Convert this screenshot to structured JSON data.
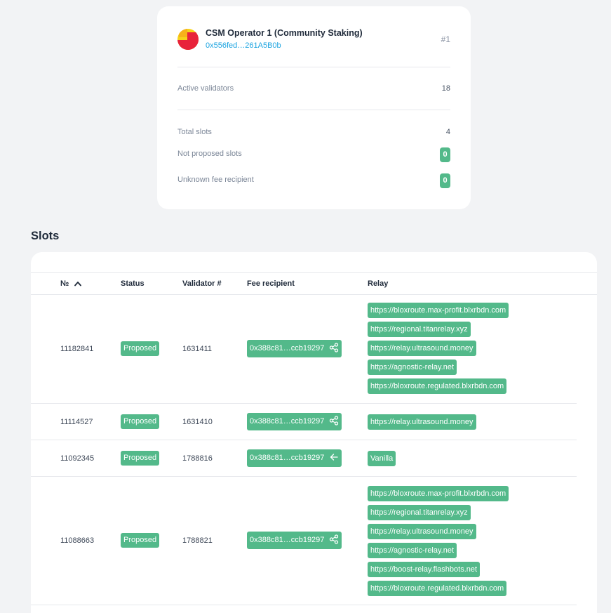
{
  "operator": {
    "name": "CSM Operator 1 (Community Staking)",
    "address": "0x556fed…261A5B0b",
    "rank": "#1",
    "active_validators_label": "Active validators",
    "active_validators": "18",
    "total_slots_label": "Total slots",
    "total_slots": "4",
    "not_proposed_label": "Not proposed slots",
    "not_proposed": "0",
    "unknown_fee_label": "Unknown fee recipient",
    "unknown_fee": "0"
  },
  "slots": {
    "title": "Slots",
    "columns": {
      "number": "№",
      "status": "Status",
      "validator": "Validator #",
      "fee_recipient": "Fee recipient",
      "relay": "Relay"
    },
    "rows": [
      {
        "slot": "11182841",
        "status": "Proposed",
        "validator": "1631411",
        "fee_recipient": "0x388c81…ccb19297",
        "fee_icon": "share-icon",
        "relays": [
          "https://bloxroute.max-profit.blxrbdn.com",
          "https://regional.titanrelay.xyz",
          "https://relay.ultrasound.money",
          "https://agnostic-relay.net",
          "https://bloxroute.regulated.blxrbdn.com"
        ]
      },
      {
        "slot": "11114527",
        "status": "Proposed",
        "validator": "1631410",
        "fee_recipient": "0x388c81…ccb19297",
        "fee_icon": "share-icon",
        "relays": [
          "https://relay.ultrasound.money"
        ]
      },
      {
        "slot": "11092345",
        "status": "Proposed",
        "validator": "1788816",
        "fee_recipient": "0x388c81…ccb19297",
        "fee_icon": "arrow-left-icon",
        "relays": [
          "Vanilla"
        ]
      },
      {
        "slot": "11088663",
        "status": "Proposed",
        "validator": "1788821",
        "fee_recipient": "0x388c81…ccb19297",
        "fee_icon": "share-icon",
        "relays": [
          "https://bloxroute.max-profit.blxrbdn.com",
          "https://regional.titanrelay.xyz",
          "https://relay.ultrasound.money",
          "https://agnostic-relay.net",
          "https://boost-relay.flashbots.net",
          "https://bloxroute.regulated.blxrbdn.com"
        ]
      }
    ]
  },
  "colors": {
    "accent_green": "#53b98a",
    "link_blue": "#1aa3e0",
    "background": "#f2f3f5"
  }
}
